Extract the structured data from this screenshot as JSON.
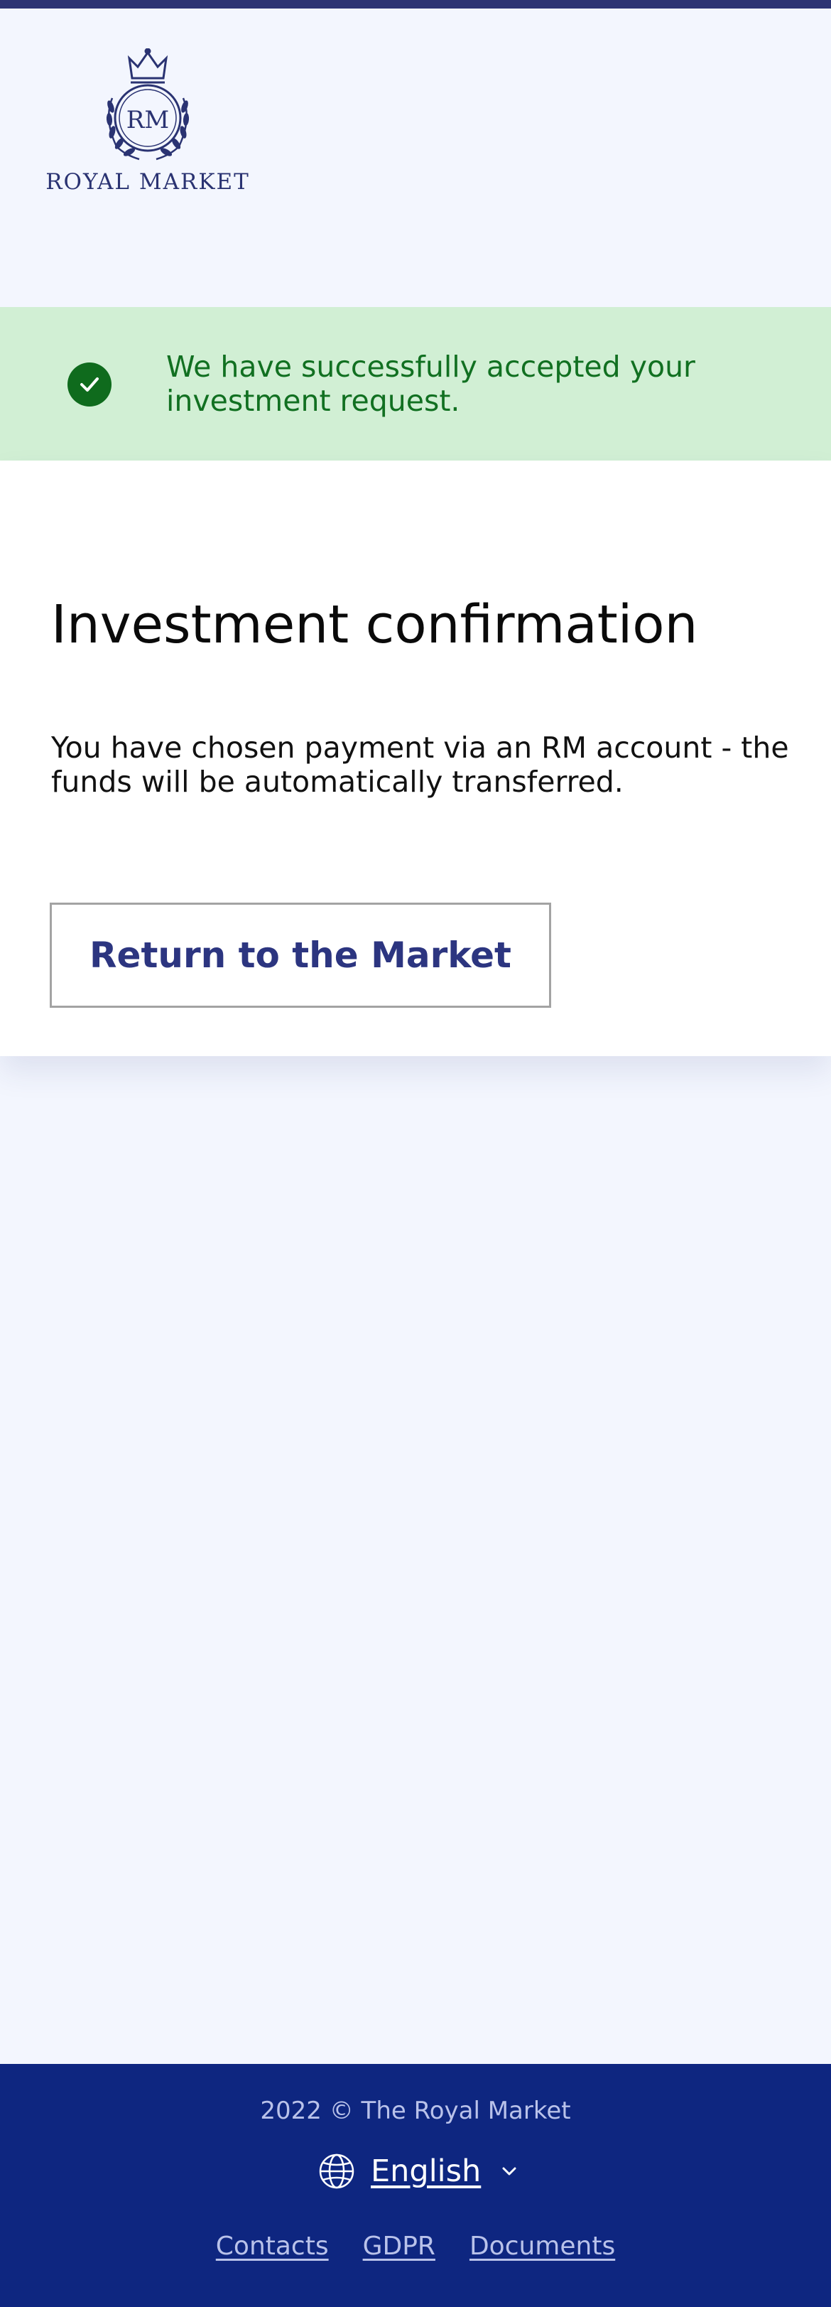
{
  "header": {
    "logo_monogram": "RM",
    "logo_text": "ROYAL MARKET"
  },
  "alert": {
    "message": "We have successfully accepted your investment request."
  },
  "card": {
    "title": "Investment confirmation",
    "body": "You have chosen payment via an RM account - the funds will be automatically transferred.",
    "button_label": "Return to the Market"
  },
  "footer": {
    "copyright": "2022 © The Royal Market",
    "language": "English",
    "links": [
      "Contacts",
      "GDPR",
      "Documents"
    ]
  },
  "colors": {
    "brand_navy": "#2d3473",
    "footer_bg": "#0e2680",
    "success_bg": "#d1efd4",
    "success_text": "#117021"
  },
  "icons": [
    "crown-logo",
    "check-icon",
    "globe-icon",
    "chevron-down-icon"
  ]
}
